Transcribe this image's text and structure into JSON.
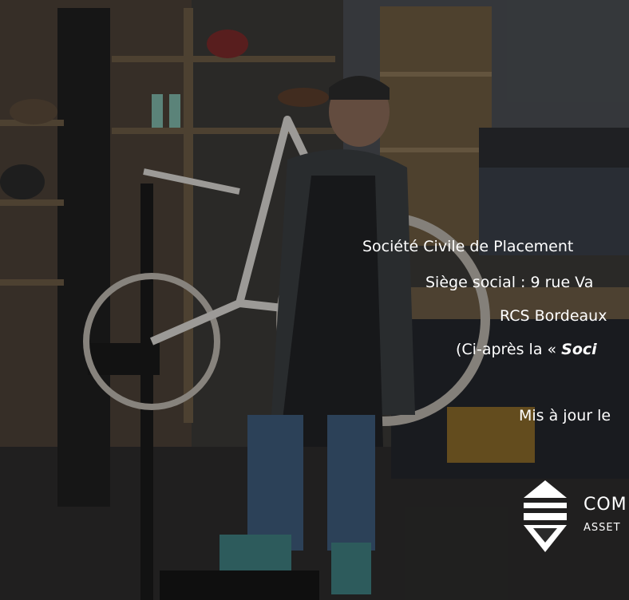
{
  "cover": {
    "line1": "Société Civile de Placement",
    "line2": "Siège social : 9 rue Va",
    "line3": "RCS Bordeaux",
    "line4_prefix": "(Ci-après la « ",
    "line4_emph": "Soci",
    "line5": "Mis à jour le"
  },
  "logo": {
    "word": "COM",
    "sub": "ASSET"
  },
  "colors": {
    "text": "#ffffff",
    "overlay": "#000000"
  }
}
